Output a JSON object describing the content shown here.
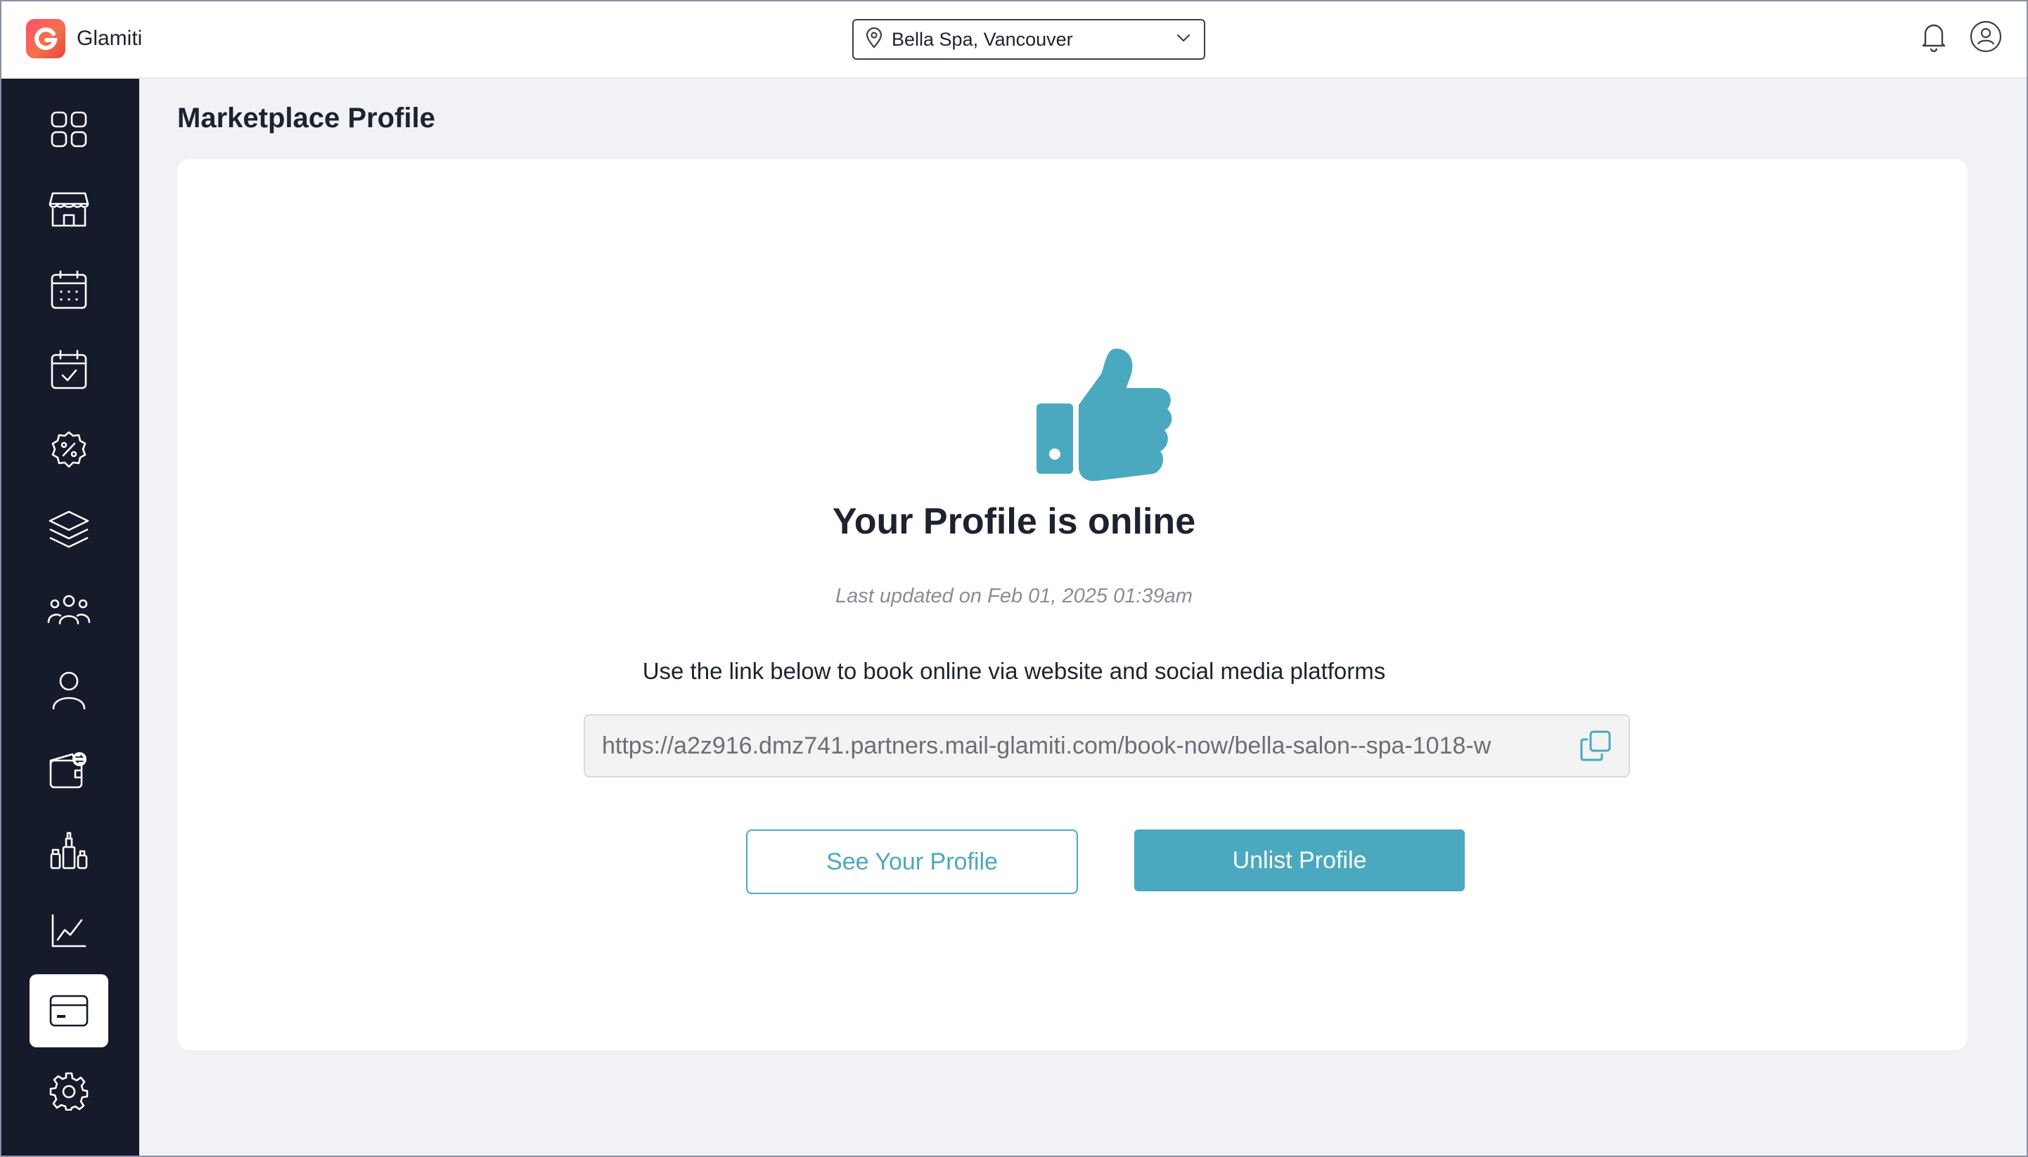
{
  "app": {
    "name": "Glamiti",
    "logo_letter": "G"
  },
  "header": {
    "location": "Bella Spa, Vancouver"
  },
  "sidebar": {
    "items": [
      {
        "name": "dashboard",
        "icon": "grid-icon"
      },
      {
        "name": "store",
        "icon": "store-icon"
      },
      {
        "name": "calendar",
        "icon": "calendar-icon"
      },
      {
        "name": "appointments",
        "icon": "calendar-check-icon"
      },
      {
        "name": "discounts",
        "icon": "discount-badge-icon"
      },
      {
        "name": "services",
        "icon": "layers-icon"
      },
      {
        "name": "clients",
        "icon": "group-icon"
      },
      {
        "name": "staff",
        "icon": "user-icon"
      },
      {
        "name": "wallet",
        "icon": "wallet-icon"
      },
      {
        "name": "products",
        "icon": "products-icon"
      },
      {
        "name": "reports",
        "icon": "line-chart-icon"
      },
      {
        "name": "marketplace",
        "icon": "card-icon",
        "active": true
      },
      {
        "name": "settings",
        "icon": "gear-icon"
      }
    ]
  },
  "main": {
    "page_title": "Marketplace Profile",
    "headline": "Your Profile is online",
    "last_updated": "Last updated on Feb 01, 2025 01:39am",
    "instruction": "Use the link below to book online via website and social media platforms",
    "profile_url": "https://a2z916.dmz741.partners.mail-glamiti.com/book-now/bella-salon--spa-1018-w",
    "see_profile_label": "See Your Profile",
    "unlist_label": "Unlist Profile"
  },
  "colors": {
    "accent": "#4aa9bf",
    "sidebar_bg": "#161b2b",
    "page_bg": "#f1f2f5"
  }
}
